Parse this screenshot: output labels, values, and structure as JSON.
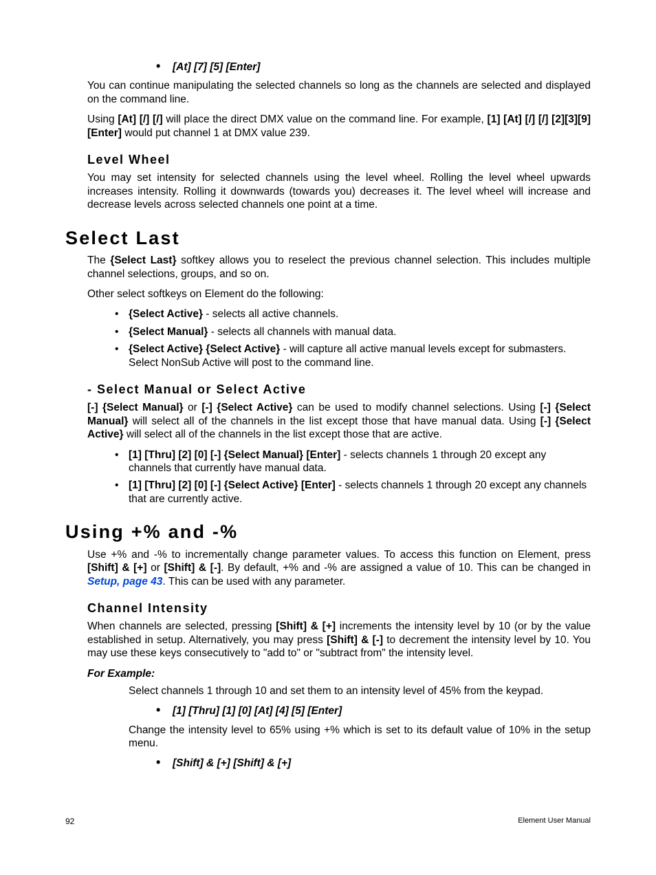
{
  "top_keyseq": "[At] [7] [5] [Enter]",
  "para_cont": "You can continue manipulating the selected channels so long as the channels are selected and displayed on the command line.",
  "para_dmx_pre": "Using ",
  "para_dmx_b1": "[At] [/] [/]",
  "para_dmx_mid": " will place the direct DMX value on the command line. For example, ",
  "para_dmx_b2": "[1] [At] [/] [/] [2][3][9] [Enter]",
  "para_dmx_post": " would put channel 1 at DMX value 239.",
  "h_level_wheel": "Level Wheel",
  "para_level_wheel": "You may set intensity for selected channels using the level wheel. Rolling the level wheel upwards increases intensity. Rolling it downwards (towards you) decreases it. The level wheel will increase and decrease levels across selected channels one point at a time.",
  "h_select_last": "Select Last",
  "sl_para1_pre": "The ",
  "sl_para1_b": "{Select Last}",
  "sl_para1_post": " softkey allows you to reselect the previous channel selection. This includes multiple channel selections, groups, and so on.",
  "sl_para2": "Other select softkeys on Element do the following:",
  "sl_b1_b": "{Select Active}",
  "sl_b1_t": " - selects all active channels.",
  "sl_b2_b": "{Select Manual}",
  "sl_b2_t": " - selects all channels with manual data.",
  "sl_b3_b": "{Select Active} {Select Active}",
  "sl_b3_t": " - will capture all active manual levels except for submasters. Select NonSub Active will post to the command line.",
  "h_sel_man_act": "- Select Manual or Select Active",
  "sma_b1": "[-] {Select Manual}",
  "sma_t1": " or ",
  "sma_b2": "[-] {Select Active}",
  "sma_t2": " can be used to modify channel selections. Using ",
  "sma_b3": "[-] {Select Manual}",
  "sma_t3": " will select all of the channels in the list except those that have manual data. Using ",
  "sma_b4": "[-] {Select Active}",
  "sma_t4": " will select all of the channels in the list except those that are active.",
  "sma_li1_b": "[1] [Thru] [2] [0] [-] {Select Manual} [Enter]",
  "sma_li1_t": " - selects channels 1 through 20 except any channels that currently have manual data.",
  "sma_li2_b": "[1] [Thru] [2] [0] [-] {Select Active} [Enter]",
  "sma_li2_t": " - selects channels 1 through 20 except any channels that are currently active.",
  "h_using_pct": "Using +% and -%",
  "up_t1": "Use +% and -% to incrementally change parameter values. To access this function on Element, press ",
  "up_b1": "[Shift] & [+]",
  "up_t2": " or ",
  "up_b2": "[Shift] & [-]",
  "up_t3": ". By default, +% and -% are assigned a value of 10. This can be changed in ",
  "up_link": "Setup, page 43",
  "up_t4": ". This can be used with any parameter.",
  "h_channel_intensity": "Channel Intensity",
  "ci_t1": "When channels are selected, pressing ",
  "ci_b1": "[Shift] & [+]",
  "ci_t2": " increments the intensity level by 10 (or by the value established in setup. Alternatively, you may press ",
  "ci_b2": "[Shift] & [-]",
  "ci_t3": " to decrement the intensity level by 10. You may use these keys consecutively to \"add to\" or \"subtract from\" the intensity level.",
  "for_example": "For Example:",
  "fe_p1": "Select channels 1 through 10 and set them to an intensity level of 45% from the keypad.",
  "fe_k1": "[1] [Thru] [1] [0] [At] [4] [5] [Enter]",
  "fe_p2": "Change the intensity level to 65% using +% which is set to its default value of 10% in the setup menu.",
  "fe_k2": "[Shift] & [+] [Shift] & [+]",
  "footer_page": "92",
  "footer_right": "Element User Manual"
}
